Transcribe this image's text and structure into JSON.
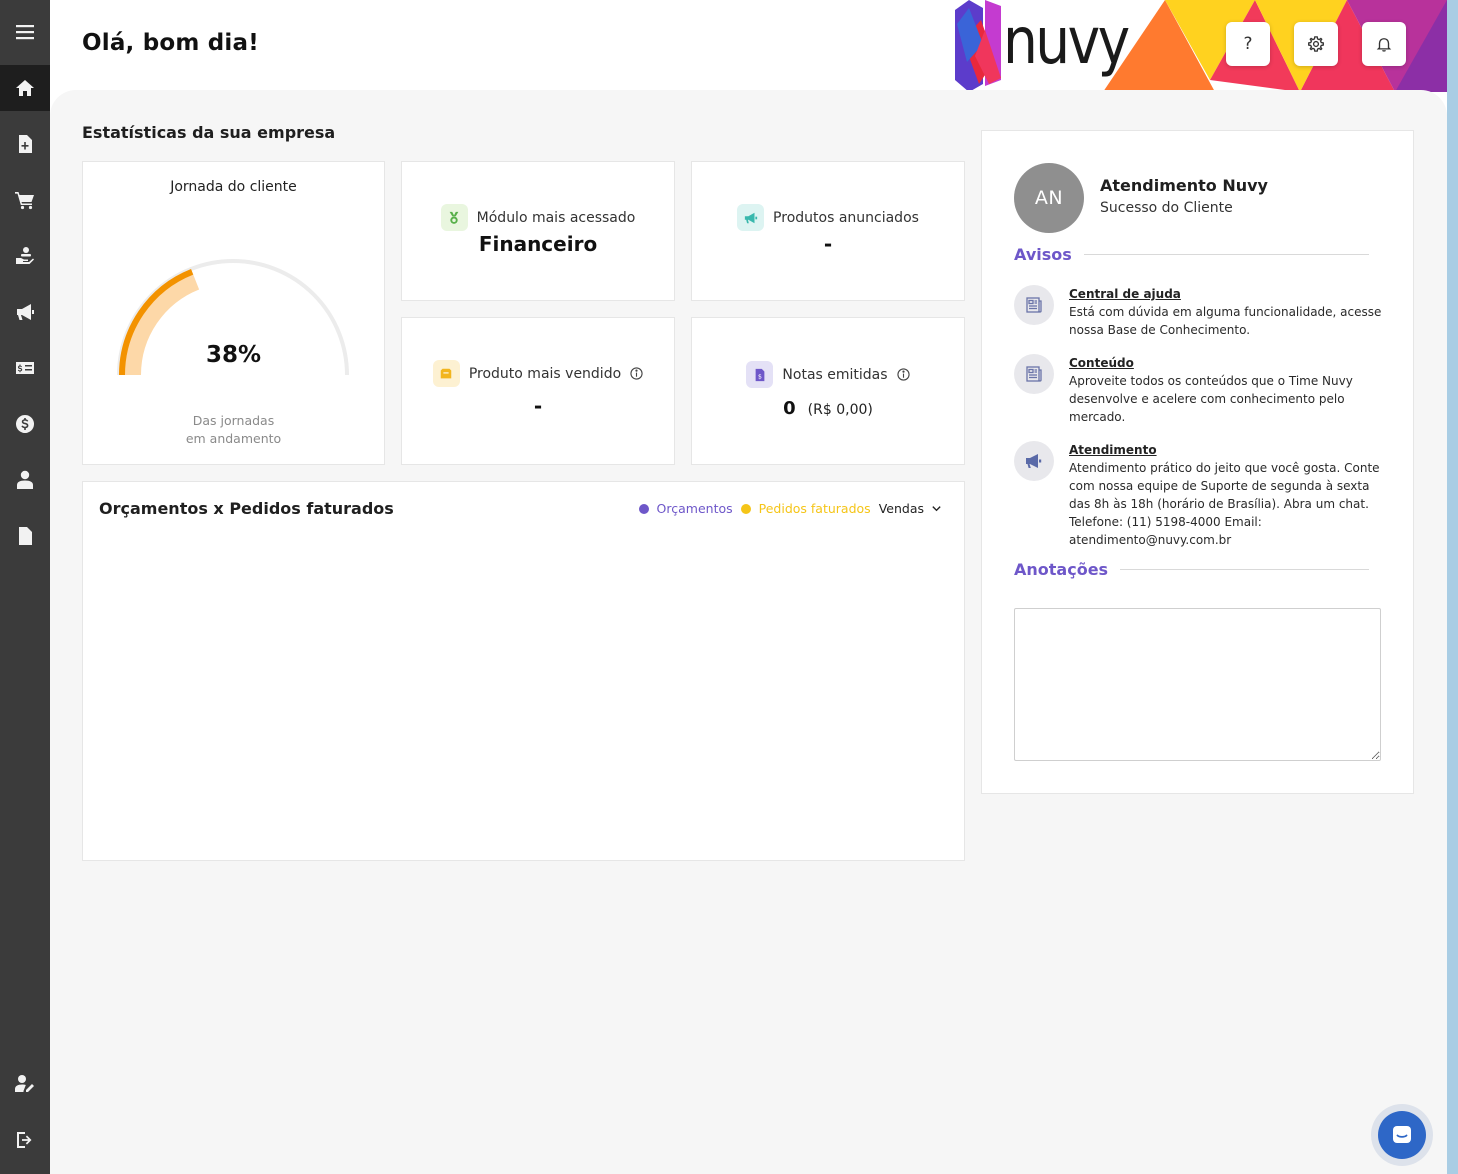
{
  "header": {
    "greeting": "Olá, bom dia!",
    "logo_text": "nuvy",
    "help_label": "?"
  },
  "sidebar": {
    "items": [
      {
        "name": "menu",
        "icon": "hamburger-icon"
      },
      {
        "name": "home",
        "icon": "home-icon",
        "active": true
      },
      {
        "name": "document-add",
        "icon": "document-plus-icon"
      },
      {
        "name": "cart",
        "icon": "cart-icon"
      },
      {
        "name": "hand-coins",
        "icon": "hand-coins-icon"
      },
      {
        "name": "megaphone",
        "icon": "megaphone-icon"
      },
      {
        "name": "finance-card",
        "icon": "money-card-icon"
      },
      {
        "name": "dollar",
        "icon": "dollar-circle-icon"
      },
      {
        "name": "contacts",
        "icon": "person-icon"
      },
      {
        "name": "file",
        "icon": "file-icon"
      }
    ],
    "bottom_items": [
      {
        "name": "edit-profile",
        "icon": "user-edit-icon"
      },
      {
        "name": "logout",
        "icon": "logout-icon"
      }
    ]
  },
  "stats": {
    "section_title": "Estatísticas da sua empresa",
    "journey": {
      "title": "Jornada do cliente",
      "percent_label": "38%",
      "percent_value": 0.38,
      "subtitle_line1": "Das jornadas",
      "subtitle_line2": "em andamento"
    },
    "most_accessed": {
      "label": "Módulo mais acessado",
      "value": "Financeiro"
    },
    "advertised": {
      "label": "Produtos anunciados",
      "value": "-"
    },
    "best_seller": {
      "label": "Produto mais vendido",
      "value": "-"
    },
    "invoices": {
      "label": "Notas emitidas",
      "count": "0",
      "amount": "(R$ 0,00)"
    }
  },
  "chart": {
    "title": "Orçamentos x Pedidos faturados",
    "legend": [
      {
        "label": "Orçamentos",
        "color": "#6e57c9"
      },
      {
        "label": "Pedidos faturados",
        "color": "#f5c518"
      }
    ],
    "select_value": "Vendas"
  },
  "panel": {
    "avatar_initials": "AN",
    "agent_name": "Atendimento Nuvy",
    "agent_role": "Sucesso do Cliente",
    "notices_title": "Avisos",
    "notices": [
      {
        "title": "Central de ajuda",
        "text": "Está com dúvida em alguma funcionalidade, acesse nossa Base de Conhecimento."
      },
      {
        "title": "Conteúdo",
        "text": "Aproveite todos os conteúdos que o Time Nuvy desenvolve e acelere com conhecimento pelo mercado."
      },
      {
        "title": "Atendimento",
        "text": "Atendimento prático do jeito que você gosta. Conte com nossa equipe de Suporte de segunda à sexta das 8h às 18h (horário de Brasília). Abra um chat. Telefone: (11) 5198-4000 Email: atendimento@nuvy.com.br"
      }
    ],
    "notes_title": "Anotações",
    "notes_value": ""
  },
  "colors": {
    "accent": "#6e57c9",
    "sidebar": "#3b3b3b",
    "gauge_fill": "#f39200",
    "gauge_light": "#fdd8a8"
  }
}
